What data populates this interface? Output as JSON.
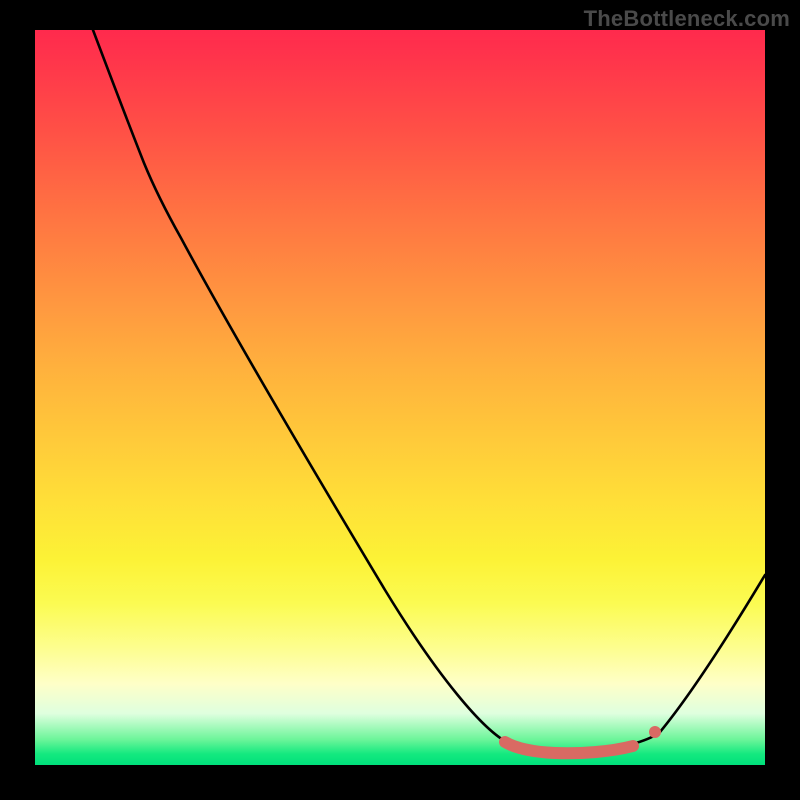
{
  "watermark": "TheBottleneck.com",
  "chart_data": {
    "type": "line",
    "title": "",
    "xlabel": "",
    "ylabel": "",
    "xlim": [
      0,
      100
    ],
    "ylim": [
      0,
      100
    ],
    "grid": false,
    "legend": false,
    "background_gradient": {
      "direction": "vertical",
      "stops": [
        {
          "pos": 0.0,
          "color": "#ff2a4d"
        },
        {
          "pos": 0.3,
          "color": "#ff7f41"
        },
        {
          "pos": 0.6,
          "color": "#ffdf38"
        },
        {
          "pos": 0.85,
          "color": "#fdfe8e"
        },
        {
          "pos": 0.95,
          "color": "#6df59a"
        },
        {
          "pos": 1.0,
          "color": "#00e07b"
        }
      ]
    },
    "series": [
      {
        "name": "curve",
        "color": "#000000",
        "x": [
          8,
          12,
          16,
          20,
          28,
          36,
          44,
          52,
          58,
          63,
          68,
          72,
          76,
          80,
          83,
          86,
          90,
          95,
          100
        ],
        "y": [
          100,
          90,
          82,
          74,
          60,
          48,
          36,
          24,
          14,
          7,
          3,
          1.5,
          1,
          1.5,
          2.5,
          4,
          8,
          15,
          26
        ]
      },
      {
        "name": "highlight-segment",
        "color": "#d96a63",
        "stroke_width": 12,
        "x": [
          64,
          68,
          72,
          76,
          80,
          82
        ],
        "y": [
          3,
          2,
          1.5,
          1,
          1.5,
          2.2
        ]
      },
      {
        "name": "highlight-dot",
        "color": "#d96a63",
        "marker": "circle",
        "x": [
          85
        ],
        "y": [
          4.5
        ]
      }
    ]
  }
}
